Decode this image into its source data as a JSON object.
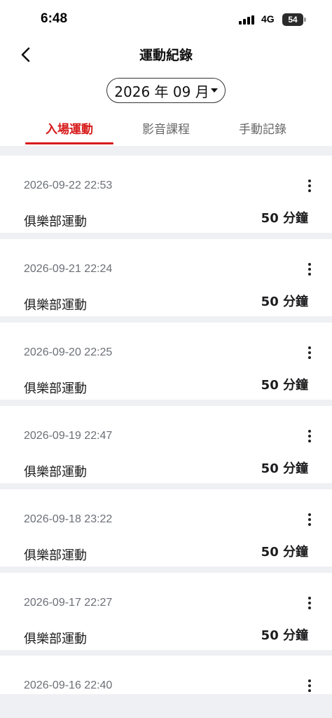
{
  "status_bar": {
    "time": "6:48",
    "network": "4G",
    "battery": "54"
  },
  "nav": {
    "title": "運動紀錄",
    "back_icon": "chevron-left-icon"
  },
  "month_picker": {
    "value": "2026 年 09 月"
  },
  "tabs": [
    {
      "label": "入場運動",
      "active": true
    },
    {
      "label": "影音課程",
      "active": false
    },
    {
      "label": "手動記錄",
      "active": false
    }
  ],
  "accent_color": "#d71a1a",
  "records": [
    {
      "timestamp": "2026-09-22 22:53",
      "type": "俱樂部運動",
      "duration": "50 分鐘"
    },
    {
      "timestamp": "2026-09-21 22:24",
      "type": "俱樂部運動",
      "duration": "50 分鐘"
    },
    {
      "timestamp": "2026-09-20 22:25",
      "type": "俱樂部運動",
      "duration": "50 分鐘"
    },
    {
      "timestamp": "2026-09-19 22:47",
      "type": "俱樂部運動",
      "duration": "50 分鐘"
    },
    {
      "timestamp": "2026-09-18 23:22",
      "type": "俱樂部運動",
      "duration": "50 分鐘"
    },
    {
      "timestamp": "2026-09-17 22:27",
      "type": "俱樂部運動",
      "duration": "50 分鐘"
    },
    {
      "timestamp": "2026-09-16 22:40",
      "type": "",
      "duration": ""
    }
  ]
}
